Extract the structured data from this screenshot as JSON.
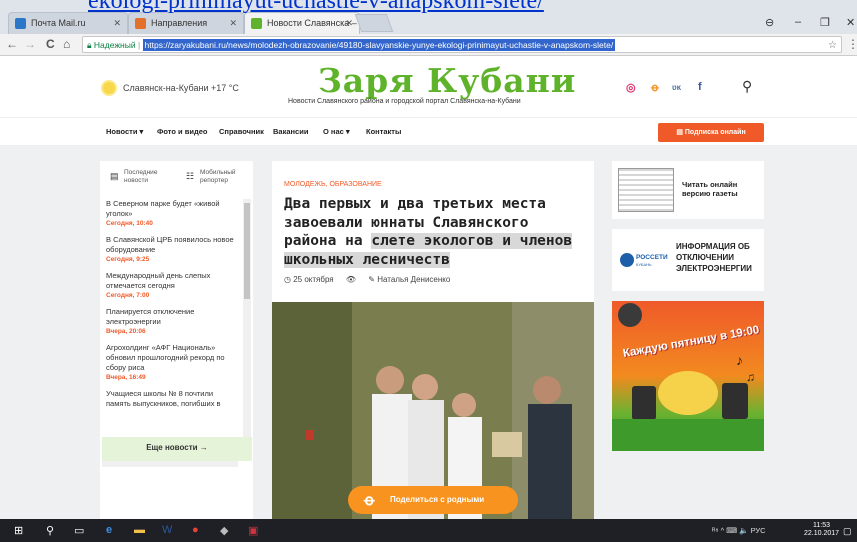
{
  "overlay_link": "ekologi-prinimayut-uchastie-v-anapskom-slete/",
  "browser": {
    "tabs": [
      {
        "label": "Почта Mail.ru",
        "icon": "mailru-favicon",
        "color": "#2a77c9"
      },
      {
        "label": "Направления",
        "icon": "directions-favicon",
        "color": "#e3702b"
      },
      {
        "label": "Новости Славянска – Д",
        "icon": "zarya-favicon",
        "color": "#5fb32a"
      }
    ],
    "tab_close": "✕",
    "window_controls": {
      "min": "–",
      "max": "❐",
      "close": "✕"
    },
    "secure_label": "Надежный",
    "url": "https://zaryakubani.ru/news/molodezh-obrazovanie/49180-slavyanskie-yunye-ekologi-prinimayut-uchastie-v-anapskom-slete/",
    "nav": {
      "back": "←",
      "forward": "→",
      "reload": "C",
      "home": "⌂",
      "star": "☆",
      "menu": "⋮"
    }
  },
  "site": {
    "weather": "Славянск-на-Кубани +17 °C",
    "logo": "Заря Кубани",
    "tagline": "Новости Славянского района и городской портал Славянска-на-Кубани",
    "social": [
      {
        "name": "instagram-icon",
        "glyph": "◎",
        "color": "#e1306c"
      },
      {
        "name": "odnoklassniki-icon",
        "glyph": "ꝋ",
        "color": "#f7931e"
      },
      {
        "name": "vk-icon",
        "glyph": "ʋĸ",
        "color": "#4a76a8"
      },
      {
        "name": "facebook-icon",
        "glyph": "f",
        "color": "#3b5998"
      }
    ],
    "search_glyph": "⚲",
    "menu": [
      "Новости ▾",
      "Фото и видео",
      "Справочник",
      "Вакансии",
      "О нас ▾",
      "Контакты"
    ],
    "subscribe": "Подписка онлайн"
  },
  "news_panel": {
    "tab_latest": "Последние новости",
    "tab_mobile": "Мобильный репортер",
    "items": [
      {
        "title": "В Северном парке будет «живой уголок»",
        "date": "Сегодня, 10:40"
      },
      {
        "title": "В Славянской ЦРБ появилось новое оборудование",
        "date": "Сегодня, 9:25"
      },
      {
        "title": "Международный день слепых отмечается сегодня",
        "date": "Сегодня, 7:00"
      },
      {
        "title": "Планируется отключение электроэнергии",
        "date": "Вчера, 20:06"
      },
      {
        "title": "Агрохолдинг «АФГ Националь» обновил прошлогодний рекорд по сбору риса",
        "date": "Вчера, 16:49"
      },
      {
        "title": "Учащиеся школы № 8 почтили память выпускников, погибших в",
        "date": ""
      }
    ],
    "more": "Еще новости   →"
  },
  "article": {
    "category": "МОЛОДЕЖЬ, ОБРАЗОВАНИЕ",
    "headline_plain": "Два первых и два третьих места завоевали юннаты Славянского района на ",
    "headline_highlight": "слете экологов и членов школьных лесничеств",
    "date": "25 октября",
    "author": "Наталья Денисенко",
    "share": "Поделиться с родными"
  },
  "sidebar": {
    "read_online": "Читать онлайн версию газеты",
    "rosseti_name": "РОССЕТИ",
    "rosseti_sub": "КУБАНЬ",
    "power_info": "ИНФОРМАЦИЯ ОБ ОТКЛЮЧЕНИИ ЭЛЕКТРОЭНЕРГИИ",
    "promo": "Каждую пятницу в 19:00"
  },
  "taskbar": {
    "tray": "ᴿ⁸  ^  ⌨ 🔈 РУС",
    "time": "11:53",
    "date": "22.10.2017"
  }
}
